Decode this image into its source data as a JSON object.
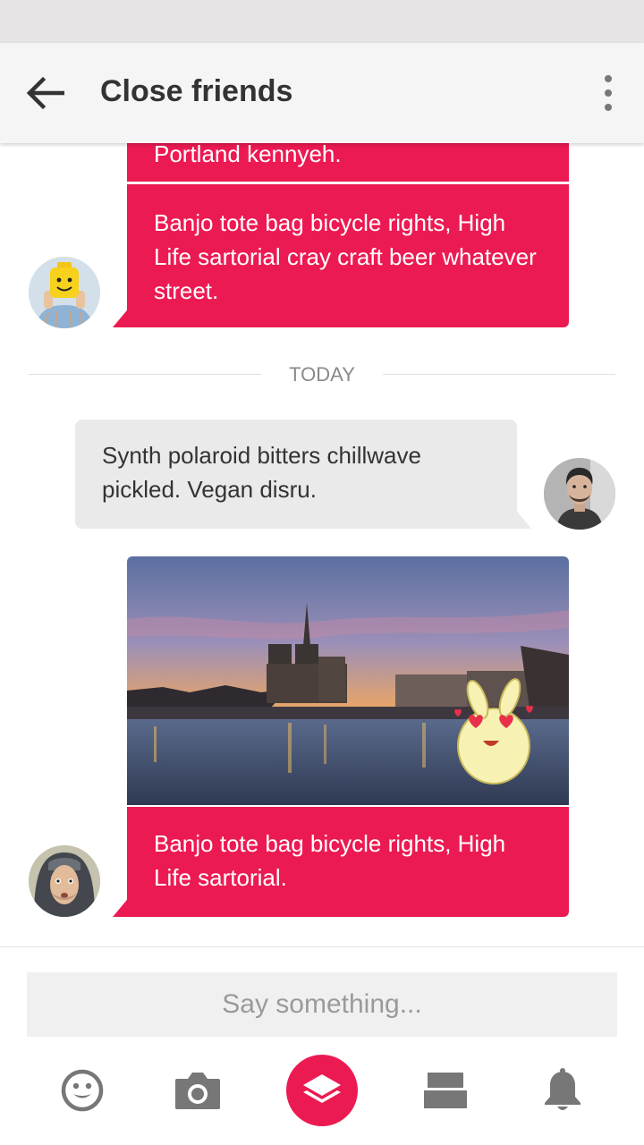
{
  "app_bar": {
    "title": "Close friends",
    "back_icon": "arrow-left-icon",
    "menu_icon": "more-vertical-icon"
  },
  "conversation": {
    "messages": [
      {
        "text": "Portland kennyeh.",
        "direction": "outgoing"
      },
      {
        "text": "Banjo tote bag bicycle rights, High Life sartorial cray craft beer whatever street.",
        "direction": "outgoing"
      },
      {
        "text": "Synth polaroid bitters chillwave pickled. Vegan disru.",
        "direction": "incoming"
      },
      {
        "text": "Banjo tote bag bicycle rights, High Life sartorial.",
        "direction": "outgoing",
        "attachment": "photo-cathedral-sunset"
      }
    ],
    "date_divider": "TODAY"
  },
  "composer": {
    "placeholder": "Say something...",
    "value": "",
    "tools": [
      "emoji-icon",
      "camera-icon",
      "layers-icon",
      "cards-icon",
      "bell-icon"
    ]
  },
  "colors": {
    "accent": "#ec1a52",
    "incoming_bubble": "#eaeaea",
    "app_bar": "#f5f5f5",
    "icon_gray": "#777777"
  }
}
